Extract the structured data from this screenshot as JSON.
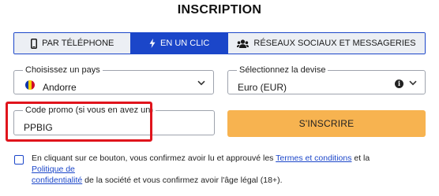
{
  "title": "INSCRIPTION",
  "tabs": [
    {
      "label": "PAR TÉLÉPHONE",
      "icon": "phone-icon",
      "active": false
    },
    {
      "label": "EN UN CLIC",
      "icon": "lightning-icon",
      "active": true
    },
    {
      "label": "RÉSEAUX SOCIAUX ET MESSAGERIES",
      "icon": "users-icon",
      "active": false
    }
  ],
  "country": {
    "label": "Choisissez un pays",
    "value": "Andorre",
    "flag_colors": [
      "#1035a8",
      "#f5d200",
      "#d00b2a"
    ]
  },
  "currency": {
    "label": "Sélectionnez la devise",
    "value": "Euro (EUR)"
  },
  "promo": {
    "label": "Code promo (si vous en avez un)",
    "value": "PPBIG"
  },
  "submit_label": "S'INSCRIRE",
  "terms": {
    "part1": "En cliquant sur ce bouton, vous confirmez avoir lu et approuvé les ",
    "link1": "Termes et conditions",
    "part2": " et la ",
    "link2a": "Politique de",
    "link2b": "confidentialité",
    "part3": " de la société et vous confirmez avoir l'âge légal (18+)."
  },
  "colors": {
    "primary": "#1b46c9",
    "accent_button": "#f7b350",
    "highlight": "#e0141c",
    "tab_bg": "#eceff4"
  }
}
